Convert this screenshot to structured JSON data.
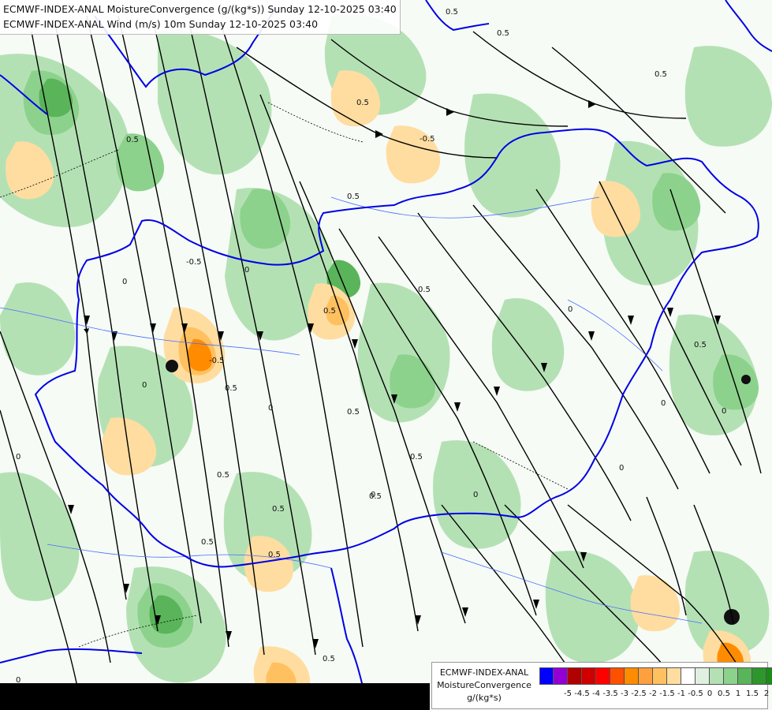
{
  "titles": {
    "line1": "ECMWF-INDEX-ANAL MoistureConvergence (g/(kg*s)) Sunday 12-10-2025 03:40",
    "line2": "ECMWF-INDEX-ANAL Wind (m/s) 10m Sunday 12-10-2025 03:40"
  },
  "legend": {
    "line1": "ECMWF-INDEX-ANAL",
    "line2": "MoistureConvergence",
    "line3": "g/(kg*s)",
    "colors": [
      "#0000ff",
      "#9400d3",
      "#b00000",
      "#d00000",
      "#ff0000",
      "#ff5000",
      "#ff8c00",
      "#ffa040",
      "#ffc060",
      "#ffdda0",
      "#ffffff",
      "#e0f0e0",
      "#b4e1b4",
      "#8cd28c",
      "#5ab45a",
      "#2d962d",
      "#1a8c1a"
    ],
    "ticks": [
      "-5",
      "-4.5",
      "-4",
      "-3.5",
      "-3",
      "-2.5",
      "-2",
      "-1.5",
      "-1",
      "-0.5",
      "0",
      "0.5",
      "1",
      "1.5",
      "2"
    ]
  },
  "map_labels": {
    "contour_values": [
      "0.5",
      "-0.5",
      "0.5",
      "0.5",
      "0.5",
      "0.5",
      "0.5",
      "-0.5",
      "0.5",
      "0.5",
      "0.5",
      "0.5",
      "0.5",
      "0.5",
      "0.5",
      "0.5",
      "0.5",
      "0.5",
      "0.5",
      "0.5",
      "-0.5"
    ],
    "zero_labels": [
      "0",
      "0",
      "0",
      "0",
      "0",
      "0",
      "0",
      "0",
      "0",
      "0",
      "0",
      "0"
    ]
  },
  "colors": {
    "border": "#0000e6",
    "river": "#4a6cff",
    "streamline": "#000000",
    "zero_contour": "#000000"
  }
}
